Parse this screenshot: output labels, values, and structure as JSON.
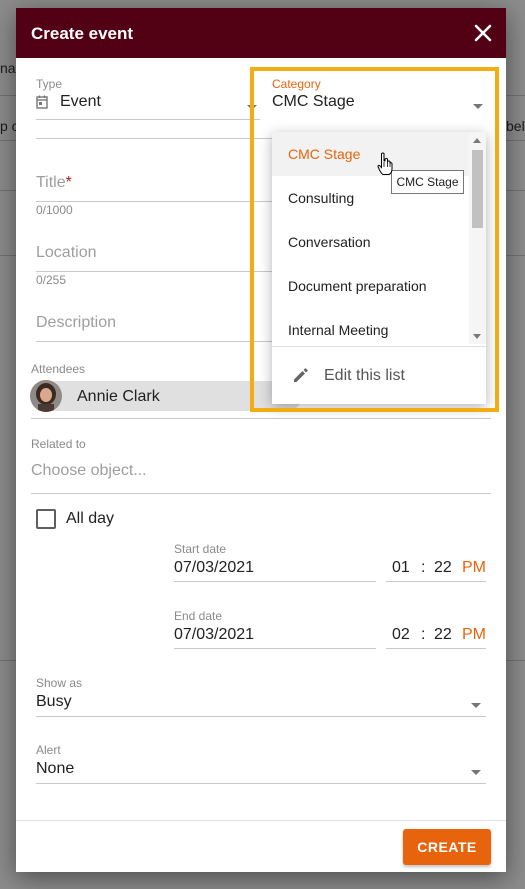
{
  "background": {
    "fragments": [
      "na",
      "p c",
      "bel"
    ]
  },
  "dialog": {
    "title": "Create event",
    "type": {
      "label": "Type",
      "value": "Event",
      "icon": "calendar-icon"
    },
    "category": {
      "label": "Category",
      "value": "CMC Stage",
      "options": [
        "CMC Stage",
        "Consulting",
        "Conversation",
        "Document preparation",
        "Internal Meeting"
      ],
      "selected_index": 0,
      "edit_label": "Edit this list",
      "tooltip": "CMC Stage"
    },
    "title_field": {
      "placeholder": "Title",
      "required_mark": "*",
      "counter": "0/1000"
    },
    "location_field": {
      "placeholder": "Location",
      "counter": "0/255"
    },
    "description_field": {
      "placeholder": "Description"
    },
    "attendees": {
      "label": "Attendees",
      "items": [
        {
          "name": "Annie Clark"
        }
      ]
    },
    "related_to": {
      "label": "Related to",
      "placeholder": "Choose object..."
    },
    "all_day": {
      "label": "All day",
      "checked": false
    },
    "start": {
      "label": "Start date",
      "date": "07/03/2021",
      "hour": "01",
      "minute": "22",
      "ampm": "PM"
    },
    "end": {
      "label": "End date",
      "date": "07/03/2021",
      "hour": "02",
      "minute": "22",
      "ampm": "PM"
    },
    "show_as": {
      "label": "Show as",
      "value": "Busy"
    },
    "alert": {
      "label": "Alert",
      "value": "None"
    },
    "create_label": "CREATE"
  },
  "colors": {
    "header": "#520014",
    "accent": "#e8640c",
    "highlight": "#f3ad12"
  }
}
